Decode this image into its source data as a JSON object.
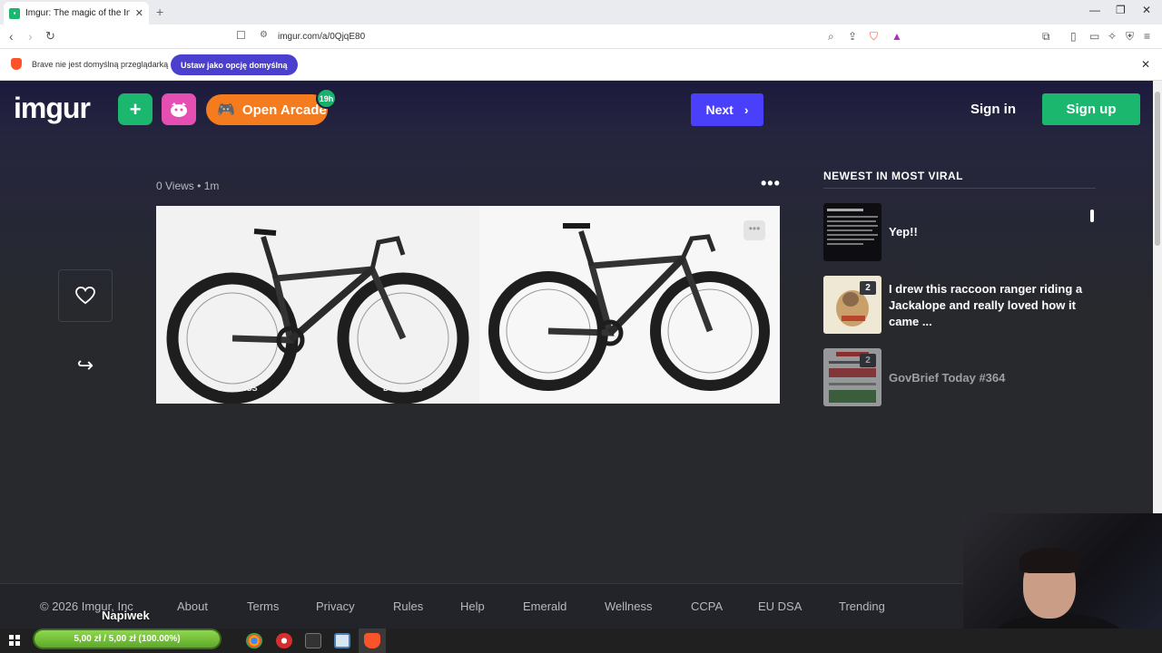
{
  "browser": {
    "tab_title": "Imgur: The magic of the Internet",
    "tab_close": "✕",
    "new_tab": "+",
    "url": "imgur.com/a/0QjqE80",
    "window_controls": [
      "—",
      "❐",
      "✕"
    ]
  },
  "infobar": {
    "message": "Brave nie jest domyślną przeglądarką",
    "button_label": "Ustaw jako opcję domyślną",
    "close": "✕"
  },
  "header": {
    "logo": "imgur",
    "upload_icon": "+",
    "arcade_label": "Open Arcade",
    "arcade_badge": "19h",
    "next_label": "Next",
    "next_chevron": "›",
    "signin_label": "Sign in",
    "signup_label": "Sign up"
  },
  "post": {
    "views": "0 Views",
    "separator": "•",
    "age": "1m",
    "more_dots": "•••",
    "image_more": "•••",
    "tire_brand": "DT SWISS",
    "share_arrow": "↪"
  },
  "sidebar": {
    "title": "NEWEST IN MOST VIRAL",
    "items": [
      {
        "title": "Yep!!",
        "count": ""
      },
      {
        "title": "I drew this raccoon ranger riding a Jackalope and really loved how it came ...",
        "count": "2"
      },
      {
        "title": "GovBrief Today #364",
        "count": "2"
      }
    ]
  },
  "footer": {
    "copyright": "© 2026 Imgur, Inc",
    "links": [
      "About",
      "Terms",
      "Privacy",
      "Rules",
      "Help",
      "Emerald",
      "Wellness",
      "CCPA",
      "EU DSA",
      "Trending"
    ]
  },
  "taskbar": {
    "tip_label": "Napiwek",
    "tip_progress": "5,00 zł / 5,00 zł (100.00%)",
    "tip_fraction": 1.0
  },
  "colors": {
    "imgur_green": "#1bb76e",
    "next_blue": "#4a3ffb",
    "arcade_orange": "#f57b1f",
    "meme_pink": "#e64fb2",
    "brave_purple": "#4a3fcf"
  }
}
